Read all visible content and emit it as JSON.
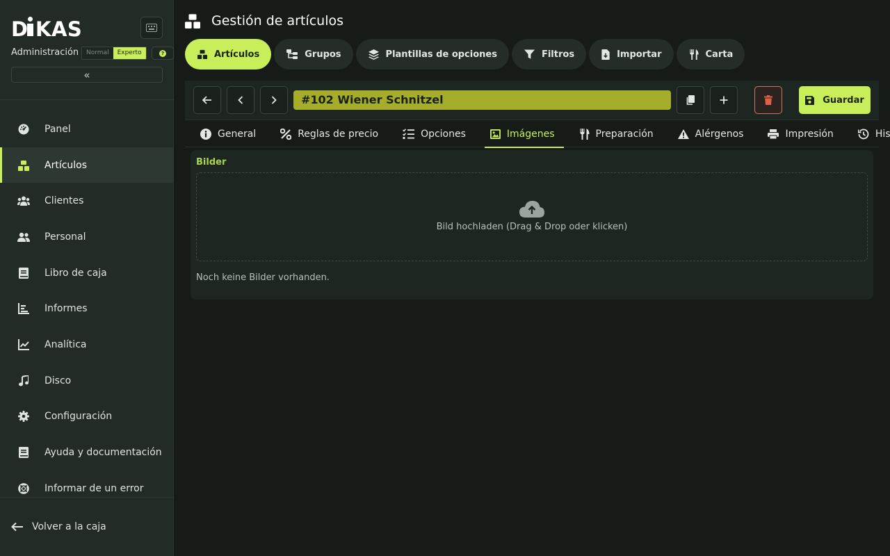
{
  "brand": {
    "logo_text": "DIKAS",
    "accent": "#c8ef5a"
  },
  "sidebar": {
    "admin_label": "Administración",
    "mode_normal": "Normal",
    "mode_expert": "Experto",
    "items": [
      {
        "label": "Panel",
        "icon": "dashboard-icon"
      },
      {
        "label": "Artículos",
        "icon": "cubes-icon"
      },
      {
        "label": "Clientes",
        "icon": "people-group-icon"
      },
      {
        "label": "Personal",
        "icon": "people-icon"
      },
      {
        "label": "Libro de caja",
        "icon": "book-icon"
      },
      {
        "label": "Informes",
        "icon": "bar-chart-icon"
      },
      {
        "label": "Analítica",
        "icon": "line-chart-icon"
      },
      {
        "label": "Disco",
        "icon": "music-icon"
      },
      {
        "label": "Configuración",
        "icon": "gear-icon"
      },
      {
        "label": "Ayuda y documentación",
        "icon": "book-icon"
      },
      {
        "label": "Informar de un error",
        "icon": "lifebuoy-icon"
      }
    ],
    "back_label": "Volver a la caja"
  },
  "header": {
    "title": "Gestión de artículos"
  },
  "top_tabs": [
    {
      "label": "Artículos",
      "icon": "cubes-icon"
    },
    {
      "label": "Grupos",
      "icon": "tree-icon"
    },
    {
      "label": "Plantillas de opciones",
      "icon": "layers-icon"
    },
    {
      "label": "Filtros",
      "icon": "filter-icon"
    },
    {
      "label": "Importar",
      "icon": "file-import-icon"
    },
    {
      "label": "Carta",
      "icon": "utensils-icon"
    }
  ],
  "toolbar": {
    "article_name": "#102 Wiener Schnitzel",
    "save_label": "Guardar"
  },
  "sub_tabs": [
    {
      "label": "General",
      "icon": "info-icon"
    },
    {
      "label": "Reglas de precio",
      "icon": "percent-icon"
    },
    {
      "label": "Opciones",
      "icon": "list-check-icon"
    },
    {
      "label": "Imágenes",
      "icon": "image-icon"
    },
    {
      "label": "Preparación",
      "icon": "utensils-icon"
    },
    {
      "label": "Alérgenos",
      "icon": "warning-icon"
    },
    {
      "label": "Impresión",
      "icon": "printer-icon"
    },
    {
      "label": "Historial",
      "icon": "history-icon"
    }
  ],
  "images_panel": {
    "title": "Bilder",
    "upload_text": "Bild hochladen (Drag & Drop oder klicken)",
    "empty_text": "Noch keine Bilder vorhanden."
  }
}
